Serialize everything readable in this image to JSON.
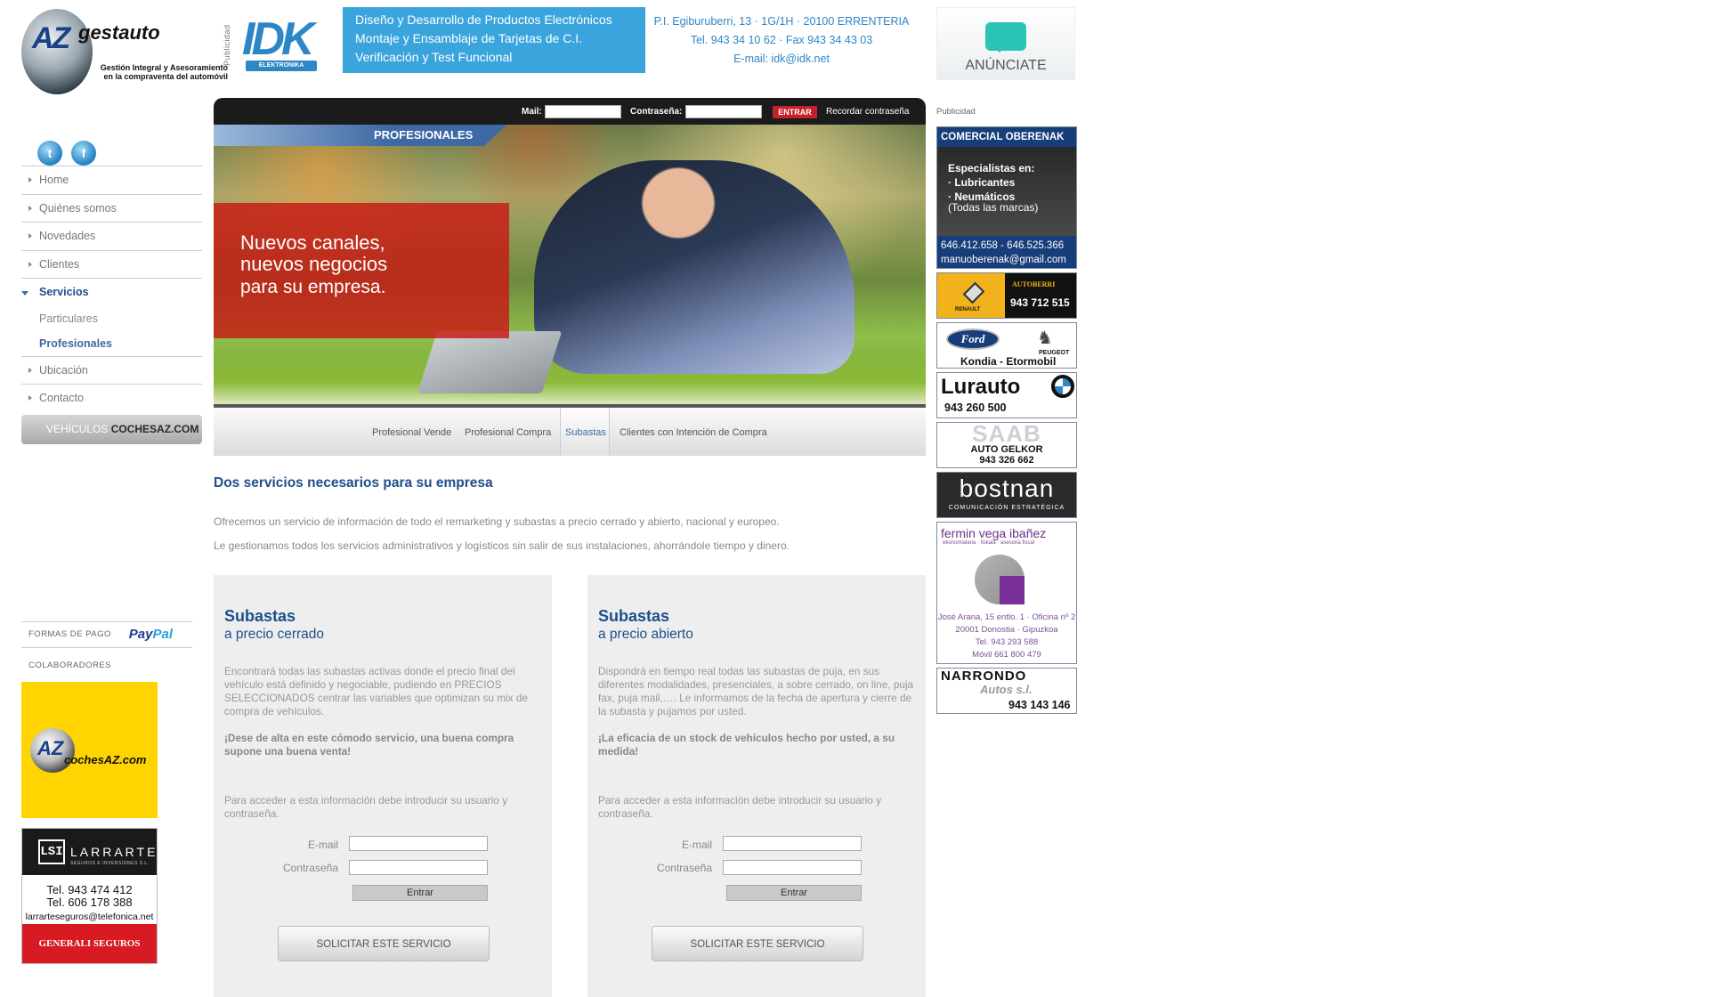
{
  "header": {
    "logo_text": "AZ",
    "logo_name": "gestauto",
    "logo_tagline": "Gestión Integral y Asesoramiento en la compraventa del automóvil",
    "publicidad_label": "Publicidad",
    "idk_logo": "IDK",
    "idk_sub": "ELEKTRONIKA",
    "idk_services": [
      "Diseño y Desarrollo de Productos Electrónicos",
      "Montaje y Ensamblaje de Tarjetas de C.I.",
      "Verificación y Test Funcional"
    ],
    "idk_address": "P.I. Egiburuberri, 13 · 1G/1H · 20100 ERRENTERIA",
    "idk_phone": "Tel. 943 34 10 62 · Fax 943 34 43 03",
    "idk_email": "E-mail: idk@idk.net",
    "anunciate": "ANÚNCIATE"
  },
  "social": {
    "twitter": "t",
    "facebook": "f"
  },
  "nav": {
    "items": [
      {
        "label": "Home"
      },
      {
        "label": "Quiénes somos"
      },
      {
        "label": "Novedades"
      },
      {
        "label": "Clientes"
      },
      {
        "label": "Servicios"
      }
    ],
    "sub": [
      "Particulares",
      "Profesionales"
    ],
    "items2": [
      {
        "label": "Ubicación"
      },
      {
        "label": "Contacto"
      }
    ],
    "coches_prefix": "VEHÍCULOS",
    "coches_brand": "COCHESAZ.COM"
  },
  "left": {
    "formas_pago": "FORMAS DE PAGO",
    "paypal_1": "Pay",
    "paypal_2": "Pal",
    "colaboradores": "COLABORADORES",
    "az2_logo": "AZ",
    "az2_name": "cochesAZ.com",
    "larrarte_icon": "LSI",
    "larrarte_name": "LARRARTE",
    "larrarte_sub": "SEGUROS E INVERSIONES S.L.",
    "larrarte_tel1": "Tel. 943 474 412",
    "larrarte_tel2": "Tel. 606 178 388",
    "larrarte_email": "larrarteseguros@telefonica.net",
    "generali": "GENERALI SEGUROS"
  },
  "login": {
    "mail_label": "Mail:",
    "pass_label": "Contraseña:",
    "enter": "ENTRAR",
    "remember": "Recordar contraseña"
  },
  "hero": {
    "tab": "PROFESIONALES",
    "line1": "Nuevos canales,",
    "line2": "nuevos negocios",
    "line3": "para su empresa."
  },
  "subnav": [
    {
      "label": "Profesional Vende"
    },
    {
      "label": "Profesional Compra"
    },
    {
      "label": "Subastas"
    },
    {
      "label": "Clientes con Intención de Compra"
    }
  ],
  "content": {
    "title": "Dos servicios necesarios para su empresa",
    "p1": "Ofrecemos un servicio de información de todo el remarketing y subastas a precio cerrado y abierto, nacional y europeo.",
    "p2": "Le gestionamos todos los servicios administrativos y logísticos sin salir de sus instalaciones, ahorrándole tiempo y dinero.",
    "boxes": [
      {
        "title": "Subastas",
        "subtitle": "a precio cerrado",
        "text": "Encontrará todas las subastas activas donde el precio final del vehículo está definido y negociable, pudiendo en PRECIOS SELECCIONADOS centrar las variables que optimizan su mix de compra de vehículos.",
        "highlight": "¡Dese de alta en este cómodo servicio, una buena compra supone una buena venta!",
        "access": "Para acceder a esta información debe introducir su usuario y contraseña.",
        "email_label": "E-mail",
        "pass_label": "Contraseña",
        "enter": "Entrar",
        "request": "SOLICITAR ESTE SERVICIO"
      },
      {
        "title": "Subastas",
        "subtitle": "a precio abierto",
        "text": "Dispondrá en tiempo real todas las subastas de puja, en sus diferentes modalidades, presenciales, a sobre cerrado, on line, puja fax, puja mail,…. Le informamos de la fecha de apertura y cierre de la subasta y pujamos por usted.",
        "highlight": "¡La eficacia de un stock de vehículos hecho por usted, a su medida!",
        "access": "Para acceder a esta información debe introducir su usuario y contraseña.",
        "email_label": "E-mail",
        "pass_label": "Contraseña",
        "enter": "Entrar",
        "request": "SOLICITAR ESTE SERVICIO"
      }
    ]
  },
  "right": {
    "publicidad": "Publicidad",
    "oberenak_title": "COMERCIAL OBERENAK",
    "oberenak_l1": "Especialistas en:",
    "oberenak_l2": "· Lubricantes",
    "oberenak_l3": "· Neumáticos",
    "oberenak_l4": "(Todas las marcas)",
    "oberenak_phone": "646.412.658 - 646.525.366",
    "oberenak_email": "manuoberenak@gmail.com",
    "renault": "RENAULT",
    "autoberri": "AUTOBERRI",
    "autoberri_phone": "943 712 515",
    "ford": "Ford",
    "peugeot": "PEUGEOT",
    "kondia": "Kondia - Etormobil",
    "lurauto": "Lurauto",
    "lurauto_phone": "943 260 500",
    "saab": "SAAB",
    "gelkor": "AUTO GELKOR",
    "gelkor_phone": "943 326 662",
    "bostnan": "bostnan",
    "bostnan_sub": "COMUNICACIÓN ESTRATÉGICA",
    "fermin": "fermin vega ibañez",
    "fermin_sub": "ekonomialaria · fiskala · asesoria fiscal",
    "fermin_addr1": "José Arana, 15 entlo. 1 · Oficina nº 2",
    "fermin_addr2": "20001 Donostia · Gipuzkoa",
    "fermin_tel": "Tel.  943 293 588",
    "fermin_mov": "Móvil 661 800 479",
    "narrondo": "NARRONDO",
    "narrondo_sub": "Autos s.l.",
    "narrondo_phone": "943 143 146"
  }
}
